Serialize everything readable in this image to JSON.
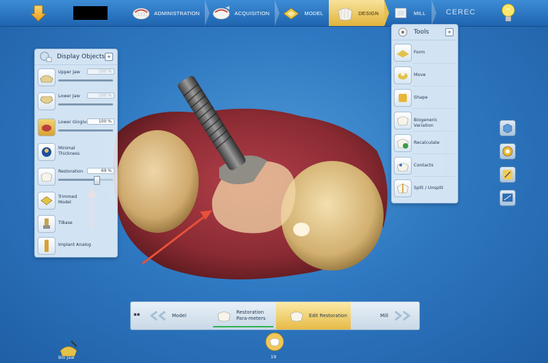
{
  "nav": {
    "items": [
      {
        "label": "ADMINISTRATION",
        "icon": "administration-icon"
      },
      {
        "label": "ACQUISITION",
        "icon": "acquisition-icon"
      },
      {
        "label": "MODEL",
        "icon": "model-icon"
      },
      {
        "label": "DESIGN",
        "icon": "design-icon",
        "active": true
      },
      {
        "label": "MILL",
        "icon": "mill-icon"
      }
    ],
    "brand": "CEREC"
  },
  "display_objects": {
    "title": "Display Objects",
    "items": [
      {
        "label": "Upper Jaw",
        "percent": "100 %",
        "level": 100,
        "dimmed": true
      },
      {
        "label": "Lower Jaw",
        "percent": "100 %",
        "level": 100,
        "dimmed": true
      },
      {
        "label": "Lower Gingiva",
        "percent": "100 %",
        "level": 100,
        "dimmed": false
      },
      {
        "label": "Minimal Thickness"
      },
      {
        "label": "Restoration",
        "percent": "69 %",
        "level": 69,
        "dimmed": false
      },
      {
        "label": "Trimmed Model"
      },
      {
        "label": "TiBase"
      },
      {
        "label": "Implant Analog"
      }
    ]
  },
  "tools": {
    "title": "Tools",
    "items": [
      "Form",
      "Move",
      "Shape",
      "Biogeneric Variation",
      "Recalculate",
      "Contacts",
      "Split / Unsplit"
    ]
  },
  "workflow": {
    "steps": [
      "Model",
      "Restoration Para-meters",
      "Edit Restoration",
      "Mill"
    ],
    "active": "Edit Restoration"
  },
  "bottom": {
    "biojaw_label": "Bio Jaw",
    "tooth_number": "19"
  },
  "colors": {
    "accent": "#e7bb45",
    "background": "#2f79c2",
    "arrow": "#e8503a"
  }
}
